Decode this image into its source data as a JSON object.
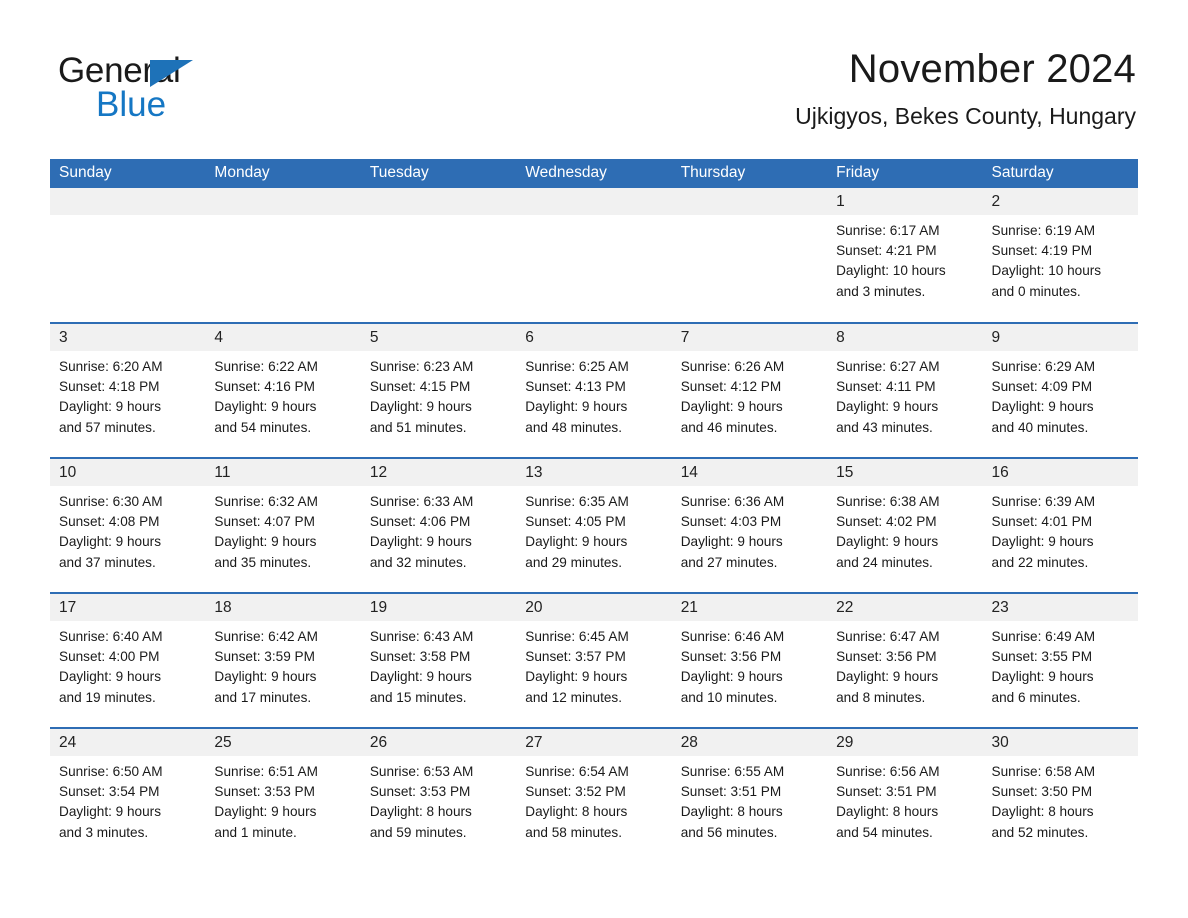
{
  "brand": {
    "line1": "General",
    "line2": "Blue",
    "triangle_color": "#1e72b8",
    "text_color": "#1a1a1a",
    "blue_text_color": "#1577c4"
  },
  "header": {
    "month_title": "November 2024",
    "location": "Ujkigyos, Bekes County, Hungary"
  },
  "theme": {
    "header_blue": "#2e6db4",
    "daynum_band": "#f1f1f1",
    "text": "#1a1a1a",
    "cell_background": "#ffffff"
  },
  "calendar": {
    "weekday_headers": [
      "Sunday",
      "Monday",
      "Tuesday",
      "Wednesday",
      "Thursday",
      "Friday",
      "Saturday"
    ],
    "labels": {
      "sunrise": "Sunrise:",
      "sunset": "Sunset:",
      "daylight": "Daylight:"
    },
    "weeks": [
      [
        {
          "day": "",
          "sunrise": "",
          "sunset": "",
          "daylight_1": "",
          "daylight_2": ""
        },
        {
          "day": "",
          "sunrise": "",
          "sunset": "",
          "daylight_1": "",
          "daylight_2": ""
        },
        {
          "day": "",
          "sunrise": "",
          "sunset": "",
          "daylight_1": "",
          "daylight_2": ""
        },
        {
          "day": "",
          "sunrise": "",
          "sunset": "",
          "daylight_1": "",
          "daylight_2": ""
        },
        {
          "day": "",
          "sunrise": "",
          "sunset": "",
          "daylight_1": "",
          "daylight_2": ""
        },
        {
          "day": "1",
          "sunrise": "Sunrise: 6:17 AM",
          "sunset": "Sunset: 4:21 PM",
          "daylight_1": "Daylight: 10 hours",
          "daylight_2": "and 3 minutes."
        },
        {
          "day": "2",
          "sunrise": "Sunrise: 6:19 AM",
          "sunset": "Sunset: 4:19 PM",
          "daylight_1": "Daylight: 10 hours",
          "daylight_2": "and 0 minutes."
        }
      ],
      [
        {
          "day": "3",
          "sunrise": "Sunrise: 6:20 AM",
          "sunset": "Sunset: 4:18 PM",
          "daylight_1": "Daylight: 9 hours",
          "daylight_2": "and 57 minutes."
        },
        {
          "day": "4",
          "sunrise": "Sunrise: 6:22 AM",
          "sunset": "Sunset: 4:16 PM",
          "daylight_1": "Daylight: 9 hours",
          "daylight_2": "and 54 minutes."
        },
        {
          "day": "5",
          "sunrise": "Sunrise: 6:23 AM",
          "sunset": "Sunset: 4:15 PM",
          "daylight_1": "Daylight: 9 hours",
          "daylight_2": "and 51 minutes."
        },
        {
          "day": "6",
          "sunrise": "Sunrise: 6:25 AM",
          "sunset": "Sunset: 4:13 PM",
          "daylight_1": "Daylight: 9 hours",
          "daylight_2": "and 48 minutes."
        },
        {
          "day": "7",
          "sunrise": "Sunrise: 6:26 AM",
          "sunset": "Sunset: 4:12 PM",
          "daylight_1": "Daylight: 9 hours",
          "daylight_2": "and 46 minutes."
        },
        {
          "day": "8",
          "sunrise": "Sunrise: 6:27 AM",
          "sunset": "Sunset: 4:11 PM",
          "daylight_1": "Daylight: 9 hours",
          "daylight_2": "and 43 minutes."
        },
        {
          "day": "9",
          "sunrise": "Sunrise: 6:29 AM",
          "sunset": "Sunset: 4:09 PM",
          "daylight_1": "Daylight: 9 hours",
          "daylight_2": "and 40 minutes."
        }
      ],
      [
        {
          "day": "10",
          "sunrise": "Sunrise: 6:30 AM",
          "sunset": "Sunset: 4:08 PM",
          "daylight_1": "Daylight: 9 hours",
          "daylight_2": "and 37 minutes."
        },
        {
          "day": "11",
          "sunrise": "Sunrise: 6:32 AM",
          "sunset": "Sunset: 4:07 PM",
          "daylight_1": "Daylight: 9 hours",
          "daylight_2": "and 35 minutes."
        },
        {
          "day": "12",
          "sunrise": "Sunrise: 6:33 AM",
          "sunset": "Sunset: 4:06 PM",
          "daylight_1": "Daylight: 9 hours",
          "daylight_2": "and 32 minutes."
        },
        {
          "day": "13",
          "sunrise": "Sunrise: 6:35 AM",
          "sunset": "Sunset: 4:05 PM",
          "daylight_1": "Daylight: 9 hours",
          "daylight_2": "and 29 minutes."
        },
        {
          "day": "14",
          "sunrise": "Sunrise: 6:36 AM",
          "sunset": "Sunset: 4:03 PM",
          "daylight_1": "Daylight: 9 hours",
          "daylight_2": "and 27 minutes."
        },
        {
          "day": "15",
          "sunrise": "Sunrise: 6:38 AM",
          "sunset": "Sunset: 4:02 PM",
          "daylight_1": "Daylight: 9 hours",
          "daylight_2": "and 24 minutes."
        },
        {
          "day": "16",
          "sunrise": "Sunrise: 6:39 AM",
          "sunset": "Sunset: 4:01 PM",
          "daylight_1": "Daylight: 9 hours",
          "daylight_2": "and 22 minutes."
        }
      ],
      [
        {
          "day": "17",
          "sunrise": "Sunrise: 6:40 AM",
          "sunset": "Sunset: 4:00 PM",
          "daylight_1": "Daylight: 9 hours",
          "daylight_2": "and 19 minutes."
        },
        {
          "day": "18",
          "sunrise": "Sunrise: 6:42 AM",
          "sunset": "Sunset: 3:59 PM",
          "daylight_1": "Daylight: 9 hours",
          "daylight_2": "and 17 minutes."
        },
        {
          "day": "19",
          "sunrise": "Sunrise: 6:43 AM",
          "sunset": "Sunset: 3:58 PM",
          "daylight_1": "Daylight: 9 hours",
          "daylight_2": "and 15 minutes."
        },
        {
          "day": "20",
          "sunrise": "Sunrise: 6:45 AM",
          "sunset": "Sunset: 3:57 PM",
          "daylight_1": "Daylight: 9 hours",
          "daylight_2": "and 12 minutes."
        },
        {
          "day": "21",
          "sunrise": "Sunrise: 6:46 AM",
          "sunset": "Sunset: 3:56 PM",
          "daylight_1": "Daylight: 9 hours",
          "daylight_2": "and 10 minutes."
        },
        {
          "day": "22",
          "sunrise": "Sunrise: 6:47 AM",
          "sunset": "Sunset: 3:56 PM",
          "daylight_1": "Daylight: 9 hours",
          "daylight_2": "and 8 minutes."
        },
        {
          "day": "23",
          "sunrise": "Sunrise: 6:49 AM",
          "sunset": "Sunset: 3:55 PM",
          "daylight_1": "Daylight: 9 hours",
          "daylight_2": "and 6 minutes."
        }
      ],
      [
        {
          "day": "24",
          "sunrise": "Sunrise: 6:50 AM",
          "sunset": "Sunset: 3:54 PM",
          "daylight_1": "Daylight: 9 hours",
          "daylight_2": "and 3 minutes."
        },
        {
          "day": "25",
          "sunrise": "Sunrise: 6:51 AM",
          "sunset": "Sunset: 3:53 PM",
          "daylight_1": "Daylight: 9 hours",
          "daylight_2": "and 1 minute."
        },
        {
          "day": "26",
          "sunrise": "Sunrise: 6:53 AM",
          "sunset": "Sunset: 3:53 PM",
          "daylight_1": "Daylight: 8 hours",
          "daylight_2": "and 59 minutes."
        },
        {
          "day": "27",
          "sunrise": "Sunrise: 6:54 AM",
          "sunset": "Sunset: 3:52 PM",
          "daylight_1": "Daylight: 8 hours",
          "daylight_2": "and 58 minutes."
        },
        {
          "day": "28",
          "sunrise": "Sunrise: 6:55 AM",
          "sunset": "Sunset: 3:51 PM",
          "daylight_1": "Daylight: 8 hours",
          "daylight_2": "and 56 minutes."
        },
        {
          "day": "29",
          "sunrise": "Sunrise: 6:56 AM",
          "sunset": "Sunset: 3:51 PM",
          "daylight_1": "Daylight: 8 hours",
          "daylight_2": "and 54 minutes."
        },
        {
          "day": "30",
          "sunrise": "Sunrise: 6:58 AM",
          "sunset": "Sunset: 3:50 PM",
          "daylight_1": "Daylight: 8 hours",
          "daylight_2": "and 52 minutes."
        }
      ]
    ]
  }
}
